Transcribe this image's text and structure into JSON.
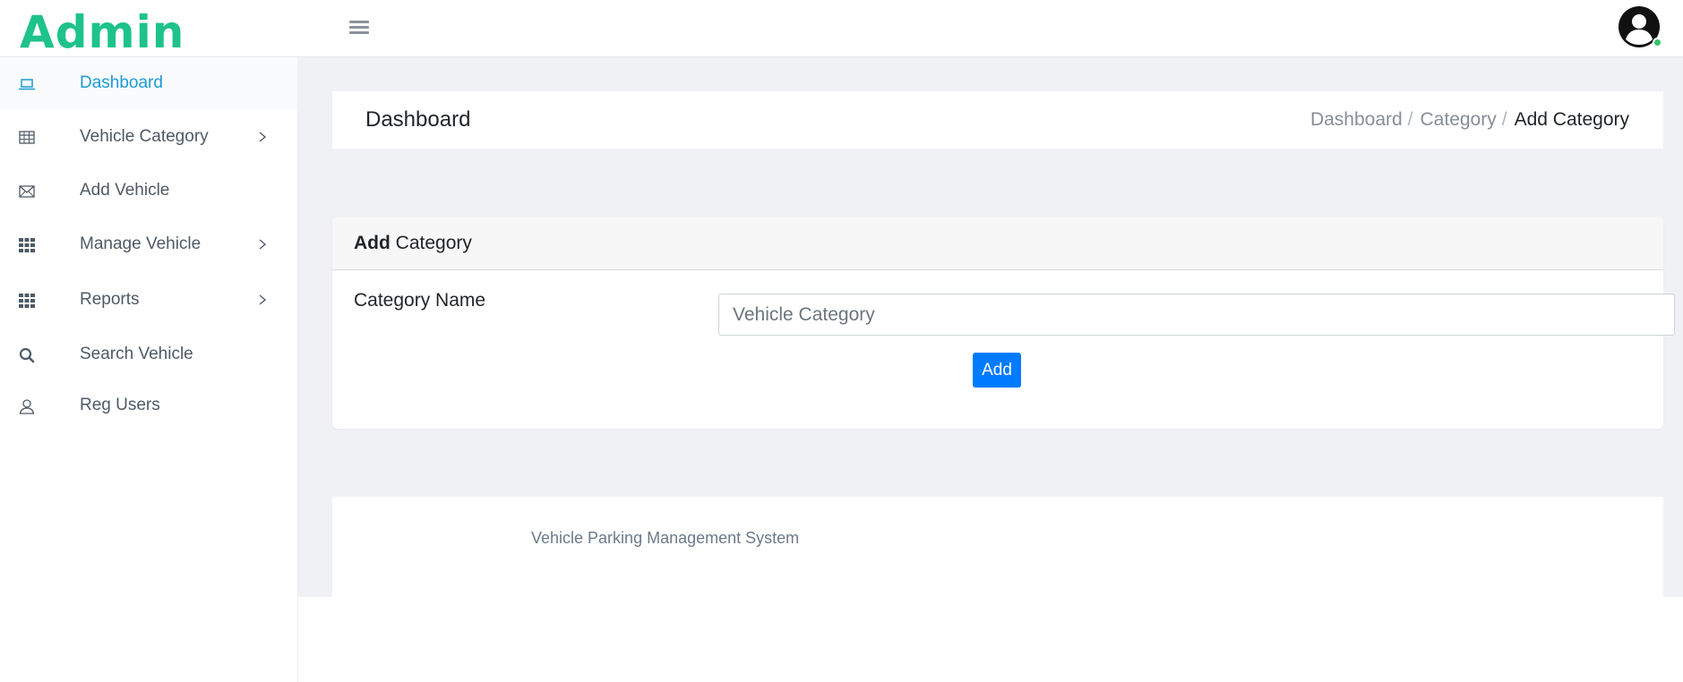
{
  "header": {
    "brand": "Admin",
    "menu_toggle_icon": "hamburger-icon",
    "avatar_icon": "user-avatar-icon",
    "status_color": "#31c46a"
  },
  "sidebar": {
    "items": [
      {
        "label": "Dashboard",
        "icon": "laptop-icon",
        "active": true,
        "has_submenu": false
      },
      {
        "label": "Vehicle Category",
        "icon": "table-icon",
        "active": false,
        "has_submenu": true
      },
      {
        "label": "Add Vehicle",
        "icon": "envelope-icon",
        "active": false,
        "has_submenu": false
      },
      {
        "label": "Manage Vehicle",
        "icon": "grid-icon",
        "active": false,
        "has_submenu": true
      },
      {
        "label": "Reports",
        "icon": "grid-icon",
        "active": false,
        "has_submenu": true
      },
      {
        "label": "Search Vehicle",
        "icon": "search-icon",
        "active": false,
        "has_submenu": false
      },
      {
        "label": "Reg Users",
        "icon": "user-icon",
        "active": false,
        "has_submenu": false
      }
    ]
  },
  "page": {
    "title": "Dashboard",
    "breadcrumb": [
      "Dashboard",
      "Category",
      "Add Category"
    ]
  },
  "card": {
    "title_bold": "Add",
    "title_rest": " Category",
    "field_label": "Category Name",
    "input_placeholder": "Vehicle Category",
    "input_value": "",
    "button_label": "Add"
  },
  "footer": {
    "text": "Vehicle Parking Management System"
  },
  "colors": {
    "brand": "#1ec28b",
    "active_nav": "#1d9bd6",
    "primary_button": "#007bff",
    "background": "#f0f1f5"
  }
}
